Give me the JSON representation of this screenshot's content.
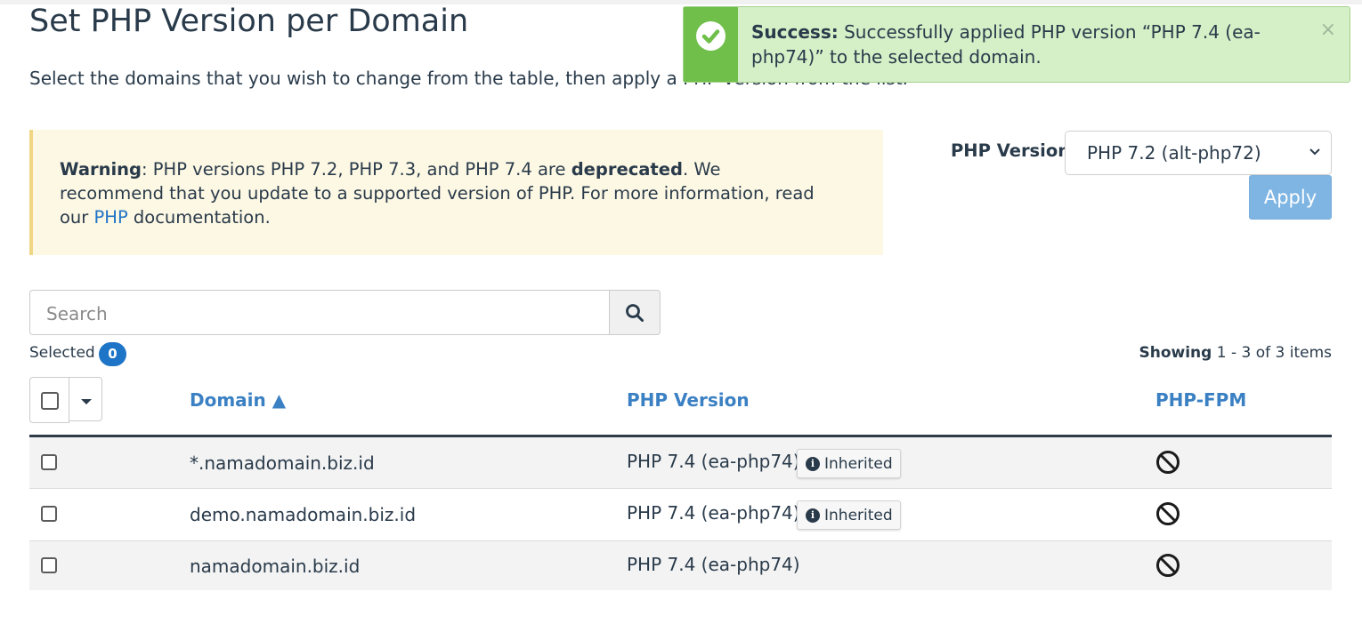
{
  "page": {
    "title": "Set PHP Version per Domain",
    "subtitle": "Select the domains that you wish to change from the table, then apply a PHP version from the list."
  },
  "warning": {
    "label": "Warning",
    "text_before": ": PHP versions PHP 7.2, PHP 7.3, and PHP 7.4 are ",
    "emphasis": "deprecated",
    "text_after": ". We recommend that you update to a supported version of PHP. For more information, read our ",
    "link": "PHP",
    "text_end": " documentation."
  },
  "php_selector": {
    "label": "PHP Version",
    "selected": "PHP 7.2 (alt-php72)",
    "apply_label": "Apply"
  },
  "search": {
    "placeholder": "Search"
  },
  "selection": {
    "label": "Selected",
    "count": "0"
  },
  "paging": {
    "prefix": "Showing",
    "range": "1 - 3 of 3 items"
  },
  "table": {
    "columns": {
      "domain": "Domain ▲",
      "php_version": "PHP Version",
      "php_fpm": "PHP-FPM"
    },
    "rows": [
      {
        "domain": "*.namadomain.biz.id",
        "version": "PHP 7.4 (ea-php74)",
        "inherited": "Inherited",
        "fpm_icon": "disabled-icon"
      },
      {
        "domain": "demo.namadomain.biz.id",
        "version": "PHP 7.4 (ea-php74)",
        "inherited": "Inherited",
        "fpm_icon": "disabled-icon"
      },
      {
        "domain": "namadomain.biz.id",
        "version": "PHP 7.4 (ea-php74)",
        "inherited": "",
        "fpm_icon": "disabled-icon"
      }
    ]
  },
  "toast": {
    "label": "Success:",
    "message": " Successfully applied PHP version “PHP 7.4 (ea-php74)” to the selected domain.",
    "close": "×"
  },
  "colors": {
    "link": "#1e74c6",
    "header_link": "#3a80c3",
    "apply": "#7fb5e3",
    "success": "#6fbf4a",
    "success_bg": "#d5efc7",
    "warning_bg": "#fdf8e4",
    "warning_border": "#f0d684"
  }
}
